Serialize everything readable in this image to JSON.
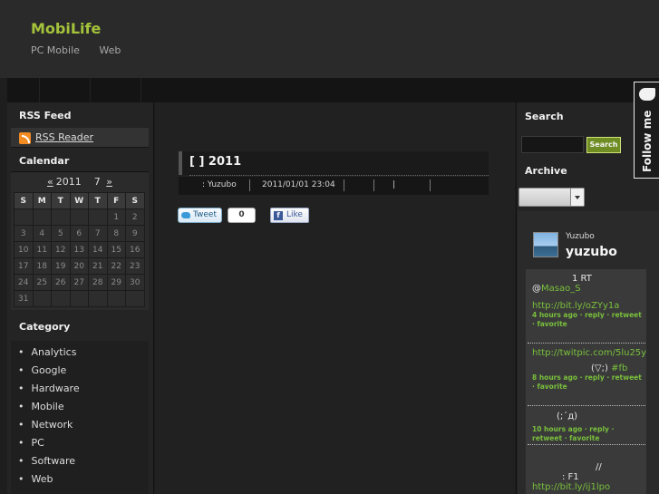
{
  "header": {
    "site_title": "MobiLife",
    "nav": [
      "PC Mobile",
      "Web"
    ]
  },
  "left": {
    "rss_title": "RSS Feed",
    "rss_link": "RSS Reader",
    "calendar_title": "Calendar",
    "calendar": {
      "prev": "«",
      "year": "2011",
      "month": "7",
      "next": "»",
      "weekdays": [
        "S",
        "M",
        "T",
        "W",
        "T",
        "F",
        "S"
      ],
      "weeks": [
        [
          "",
          "",
          "",
          "",
          "",
          "1",
          "2"
        ],
        [
          "3",
          "4",
          "5",
          "6",
          "7",
          "8",
          "9"
        ],
        [
          "10",
          "11",
          "12",
          "13",
          "14",
          "15",
          "16"
        ],
        [
          "17",
          "18",
          "19",
          "20",
          "21",
          "22",
          "23"
        ],
        [
          "24",
          "25",
          "26",
          "27",
          "28",
          "29",
          "30"
        ],
        [
          "31",
          "",
          "",
          "",
          "",
          "",
          ""
        ]
      ]
    },
    "category_title": "Category",
    "categories": [
      "Analytics",
      "Google",
      "Hardware",
      "Mobile",
      "Network",
      "PC",
      "Software",
      "Web"
    ]
  },
  "post": {
    "title": "[ ] 2011",
    "author": ": Yuzubo",
    "date": "2011/01/01 23:04",
    "meta_pipe": "|",
    "tweet_label": "Tweet",
    "tweet_count": "0",
    "like_label": "Like"
  },
  "right": {
    "search_title": "Search",
    "search_button": "Search",
    "archive_title": "Archive",
    "follow_label": "Follow me",
    "twitter": {
      "handle": "Yuzubo",
      "name": "yuzubo",
      "tweets": [
        {
          "line1": "1 RT",
          "line2a": "@",
          "line2b": "Masao_S",
          "link": "http://bit.ly/oZYy1a",
          "meta": "4 hours ago · reply · retweet · favorite"
        },
        {
          "link": "http://twitpic.com/5lu25y",
          "line2": "(▽;)",
          "tag": "#fb",
          "meta": "8 hours ago · reply · retweet · favorite"
        },
        {
          "line1": "(;´д)",
          "meta": "10 hours ago · reply · retweet · favorite"
        },
        {
          "line1": "//",
          "line2": ": F1",
          "link": "http://bit.ly/ij1lpo"
        }
      ]
    }
  }
}
